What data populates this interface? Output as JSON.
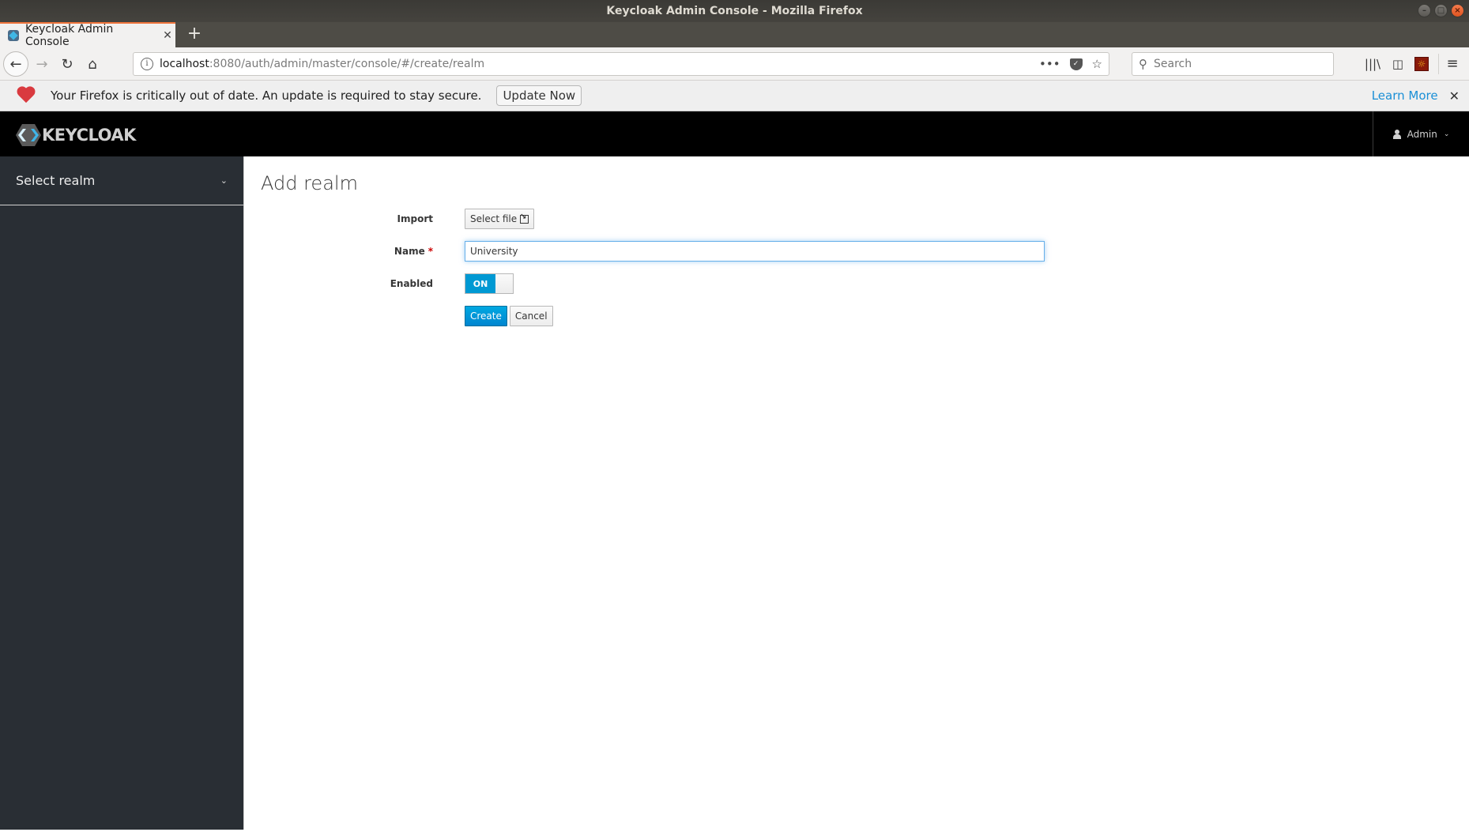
{
  "window": {
    "title": "Keycloak Admin Console - Mozilla Firefox",
    "controls": {
      "minimize": "–",
      "maximize": "□",
      "close": "×"
    }
  },
  "browser": {
    "tabs": [
      {
        "title": "Keycloak Admin Console",
        "active": true,
        "close_glyph": "✕"
      }
    ],
    "new_tab_glyph": "+",
    "nav": {
      "back": "←",
      "forward": "→",
      "reload": "↻",
      "home": "⌂"
    },
    "url": {
      "host": "localhost",
      "path": ":8080/auth/admin/master/console/#/create/realm",
      "info_glyph": "i"
    },
    "url_actions": {
      "more": "•••",
      "pocket": "✓",
      "bookmark": "☆"
    },
    "search": {
      "placeholder": "Search",
      "glyph": "⚲"
    },
    "toolbar": {
      "library": "|||\\",
      "sidebar": "◫",
      "extension": "☼",
      "menu": "≡"
    }
  },
  "notification": {
    "message": "Your Firefox is critically out of date. An update is required to stay secure.",
    "update_button": "Update Now",
    "learn_more": "Learn More",
    "close_glyph": "✕"
  },
  "app": {
    "brand": "KEYCLOAK",
    "user_menu": {
      "label": "Admin",
      "caret": "⌄"
    }
  },
  "sidebar": {
    "realm_select": {
      "label": "Select realm",
      "caret": "⌄"
    }
  },
  "main": {
    "title": "Add realm",
    "form": {
      "import": {
        "label": "Import",
        "button": "Select file"
      },
      "name": {
        "label": "Name",
        "required_marker": "*",
        "value": "University"
      },
      "enabled": {
        "label": "Enabled",
        "state": "ON",
        "value": true
      },
      "actions": {
        "create": "Create",
        "cancel": "Cancel"
      }
    }
  },
  "colors": {
    "primary": "#0099d3",
    "header_bg": "#000000",
    "sidebar_bg": "#292e34",
    "link": "#1a8fd6",
    "required": "#cc0000"
  }
}
